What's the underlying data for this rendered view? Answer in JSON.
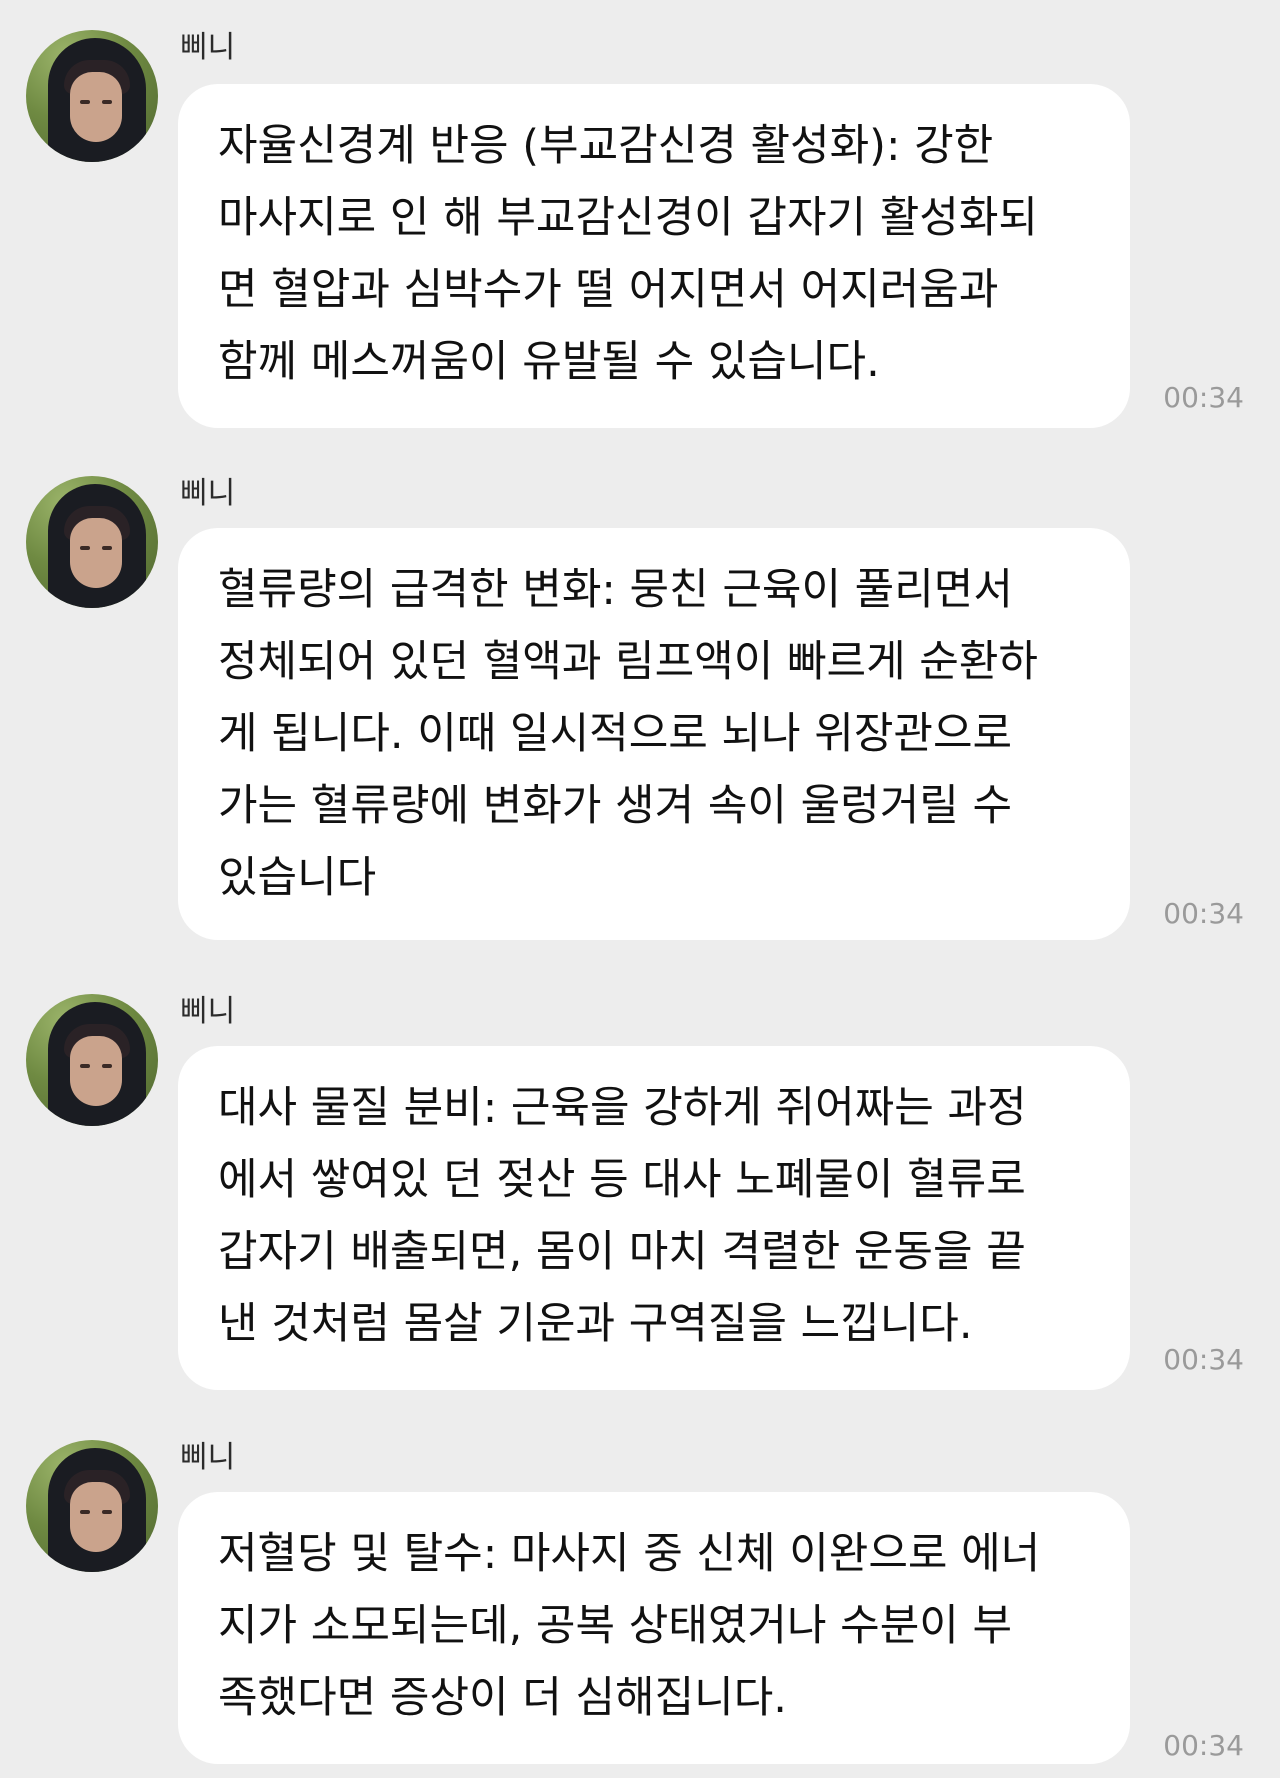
{
  "messages": [
    {
      "sender": "삐니",
      "text": "자율신경계 반응 (부교감신경 활성화): 강한\n마사지로 인 해 부교감신경이 갑자기 활성화되\n면 혈압과 심박수가 떨 어지면서 어지러움과\n함께 메스꺼움이 유발될 수 있습니다.",
      "time": "00:34"
    },
    {
      "sender": "삐니",
      "text": "혈류량의 급격한 변화: 뭉친 근육이 풀리면서\n정체되어 있던 혈액과 림프액이 빠르게 순환하\n게 됩니다. 이때 일시적으로 뇌나 위장관으로\n가는 혈류량에 변화가 생겨 속이 울렁거릴 수\n있습니다",
      "time": "00:34"
    },
    {
      "sender": "삐니",
      "text": "대사 물질 분비: 근육을 강하게 쥐어짜는 과정\n에서 쌓여있 던 젖산 등 대사 노폐물이 혈류로\n갑자기 배출되면, 몸이 마치 격렬한 운동을 끝\n낸 것처럼 몸살 기운과 구역질을 느낍니다.",
      "time": "00:34"
    },
    {
      "sender": "삐니",
      "text": "저혈당 및 탈수: 마사지 중 신체 이완으로 에너\n지가 소모되는데, 공복 상태였거나 수분이 부\n족했다면 증상이 더 심해집니다.",
      "time": "00:34"
    }
  ],
  "colors": {
    "background": "#ededed",
    "bubble": "#ffffff",
    "text": "#111111",
    "time": "#9a9a9a"
  },
  "icons": {
    "avatar": "profile-photo-hooded-person"
  }
}
